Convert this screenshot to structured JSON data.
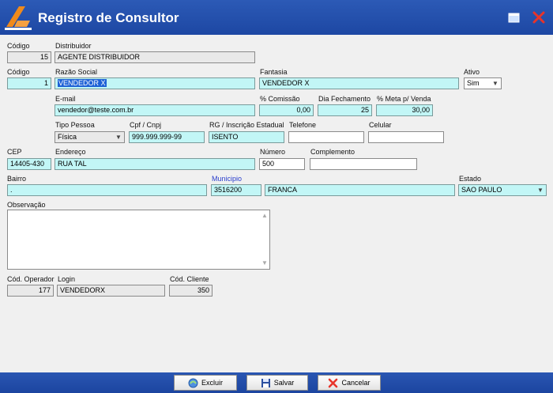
{
  "window": {
    "title": "Registro de Consultor"
  },
  "distribuidor": {
    "codigo_label": "Código",
    "codigo": "15",
    "nome_label": "Distribuidor",
    "nome": "AGENTE DISTRIBUIDOR"
  },
  "consultor": {
    "codigo_label": "Código",
    "codigo": "1",
    "razao_label": "Razão Social",
    "razao": "VENDEDOR X",
    "fantasia_label": "Fantasia",
    "fantasia": "VENDEDOR X",
    "ativo_label": "Ativo",
    "ativo": "Sim",
    "email_label": "E-mail",
    "email": "vendedor@teste.com.br",
    "comissao_label": "% Comissão",
    "comissao": "0,00",
    "dia_label": "Dia Fechamento",
    "dia": "25",
    "meta_label": "% Meta p/ Venda",
    "meta": "30,00",
    "tipo_label": "Tipo Pessoa",
    "tipo": "Física",
    "cpf_label": "Cpf / Cnpj",
    "cpf": "999.999.999-99",
    "rg_label": "RG / Inscrição Estadual",
    "rg": "ISENTO",
    "telefone_label": "Telefone",
    "telefone": "",
    "celular_label": "Celular",
    "celular": ""
  },
  "endereco": {
    "cep_label": "CEP",
    "cep": "14405-430",
    "endereco_label": "Endereço",
    "endereco": "RUA TAL",
    "numero_label": "Número",
    "numero": "500",
    "complemento_label": "Complemento",
    "complemento": "",
    "bairro_label": "Bairro",
    "bairro": ".",
    "municipio_label": "Municipio",
    "municipio_codigo": "3516200",
    "municipio_nome": "FRANCA",
    "estado_label": "Estado",
    "estado": "SAO PAULO"
  },
  "observacao": {
    "label": "Observação",
    "value": ""
  },
  "operador": {
    "cod_label": "Cód. Operador",
    "cod": "177",
    "login_label": "Login",
    "login": "VENDEDORX",
    "cliente_label": "Cód. Cliente",
    "cliente": "350"
  },
  "buttons": {
    "excluir": "Excluir",
    "salvar": "Salvar",
    "cancelar": "Cancelar"
  },
  "colors": {
    "titlebar": "#1d47a3",
    "editable": "#c2f6f6",
    "accent": "#f08a1c"
  }
}
